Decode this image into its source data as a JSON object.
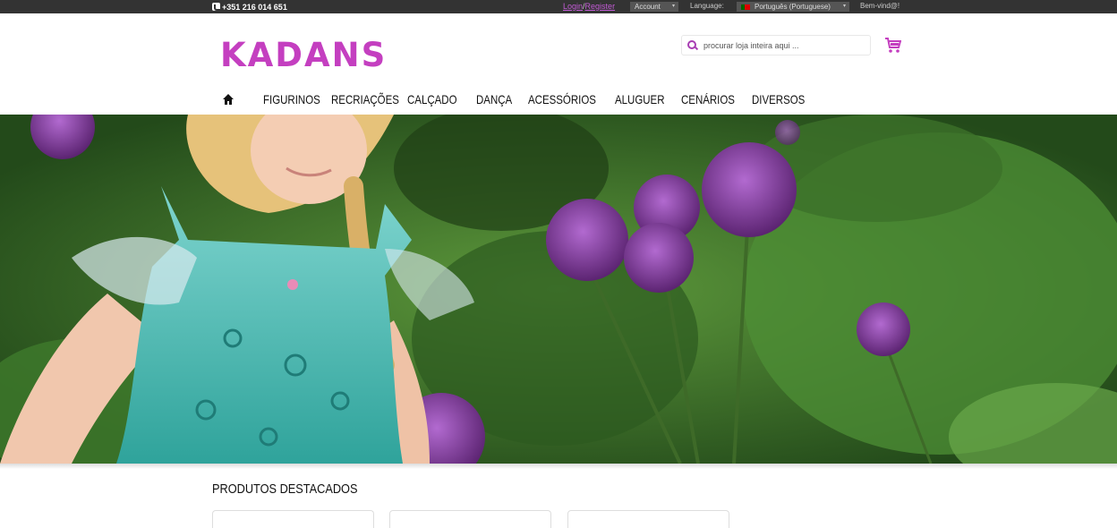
{
  "topbar": {
    "phone": "+351 216 014 651",
    "login": "Login",
    "separator": "/",
    "register": "Register",
    "account": "Account",
    "language_label": "Language:",
    "language_value": "Português (Portuguese)",
    "welcome": "Bem-vind@!"
  },
  "header": {
    "logo_text": "KADANS",
    "search_placeholder": "procurar loja inteira aqui ..."
  },
  "nav": {
    "items": [
      "FIGURINOS",
      "RECRIAÇÕES",
      "CALÇADO",
      "DANÇA",
      "ACESSÓRIOS",
      "ALUGUER",
      "CENÁRIOS",
      "DIVERSOS"
    ]
  },
  "featured": {
    "title": "PRODUTOS DESTACADOS"
  },
  "colors": {
    "brand": "#c43fc0",
    "topbar": "#333333",
    "link": "#c35bd6"
  },
  "icons": [
    "phone-icon",
    "flag-portugal-icon",
    "search-icon",
    "cart-icon",
    "home-icon"
  ]
}
